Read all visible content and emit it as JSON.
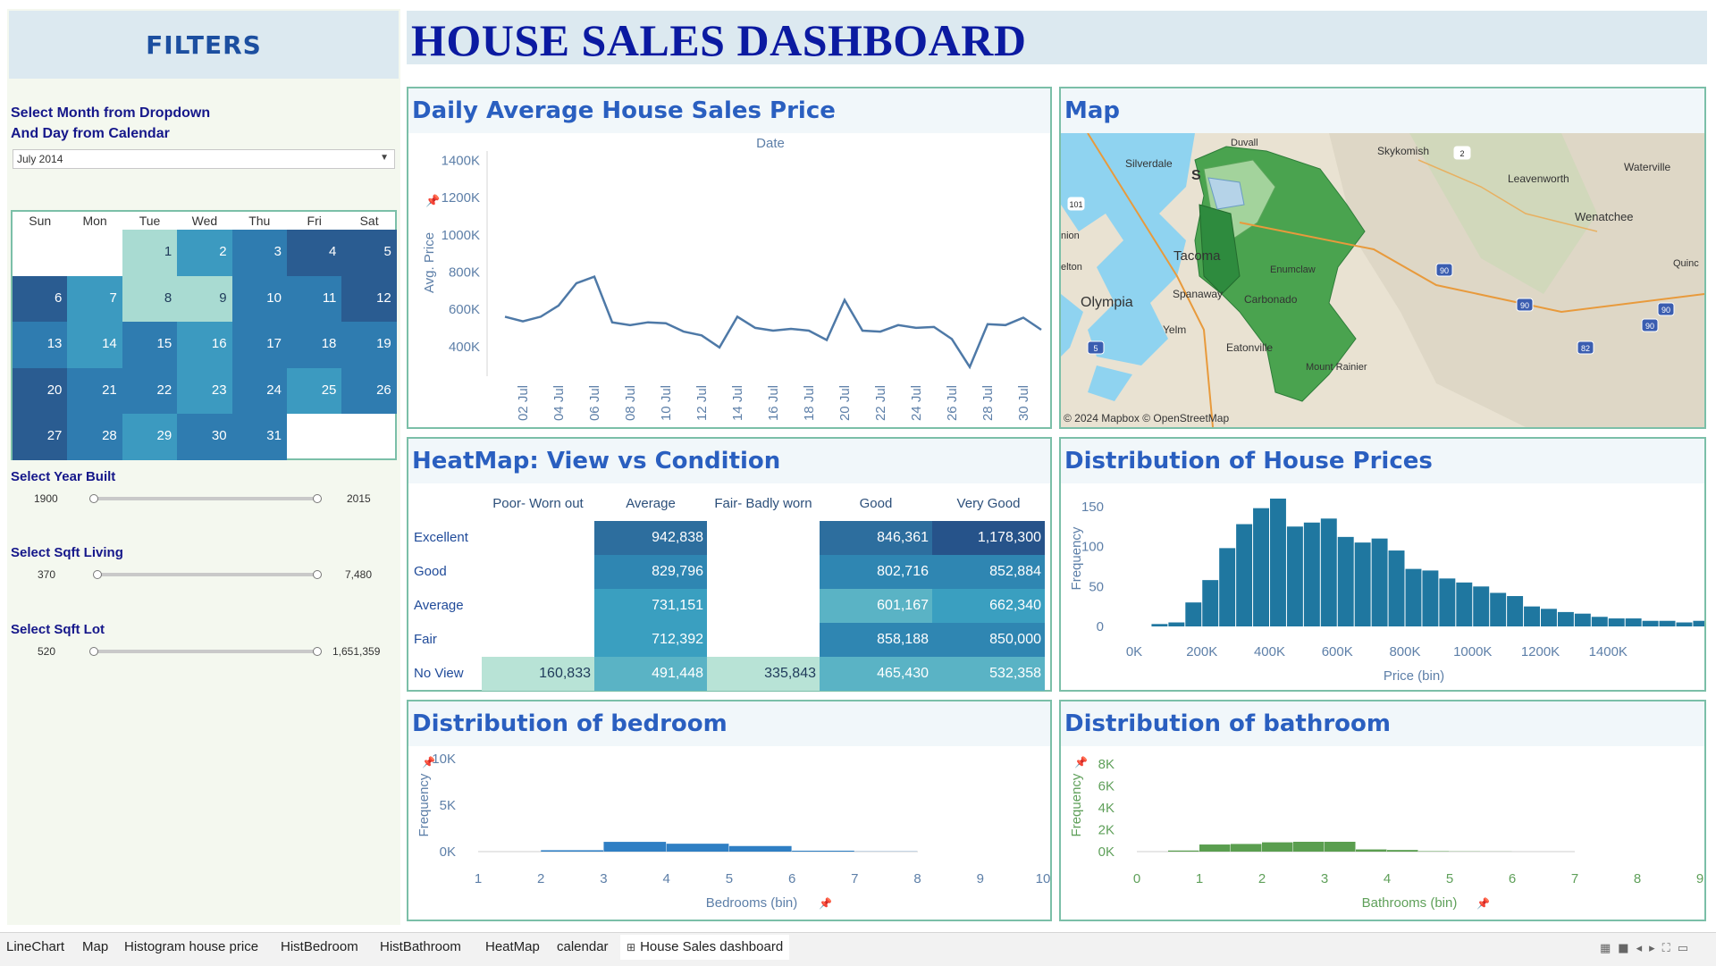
{
  "filters": {
    "header": "FILTERS",
    "month_label_1": "Select Month from Dropdown",
    "month_label_2": "And Day from Calendar",
    "month_value": "July 2014",
    "calendar": {
      "days": [
        "Sun",
        "Mon",
        "Tue",
        "Wed",
        "Thu",
        "Fri",
        "Sat"
      ],
      "start_offset": 2,
      "dates": [
        "1",
        "2",
        "3",
        "4",
        "5",
        "6",
        "7",
        "8",
        "9",
        "10",
        "11",
        "12",
        "13",
        "14",
        "15",
        "16",
        "17",
        "18",
        "19",
        "20",
        "21",
        "22",
        "23",
        "24",
        "25",
        "26",
        "27",
        "28",
        "29",
        "30",
        "31"
      ],
      "levels": [
        4,
        3,
        2,
        1,
        1,
        1,
        3,
        4,
        4,
        2,
        2,
        1,
        2,
        3,
        2,
        3,
        2,
        2,
        2,
        1,
        2,
        2,
        3,
        2,
        3,
        2,
        1,
        2,
        3,
        2,
        2
      ]
    },
    "year_built": {
      "label": "Select Year Built",
      "min": "1900",
      "max": "2015"
    },
    "sqft_living": {
      "label": "Select Sqft Living",
      "min": "370",
      "max": "7,480"
    },
    "sqft_lot": {
      "label": "Select Sqft Lot",
      "min": "520",
      "max": "1,651,359"
    }
  },
  "title": "HOUSE SALES DASHBOARD",
  "line_panel": {
    "title": "Daily Average House Sales Price"
  },
  "map_panel": {
    "title": "Map",
    "labels": {
      "duvall": "Duvall",
      "skykomish": "Skykomish",
      "waterville": "Waterville",
      "silverdale": "Silverdale",
      "seattle": "S",
      "leavenworth": "Leavenworth",
      "wenatchee": "Wenatchee",
      "tacoma": "Tacoma",
      "olympia": "Olympia",
      "spanaway": "Spanaway",
      "carbonado": "Carbonado",
      "yelm": "Yelm",
      "eatonville": "Eatonville",
      "enumclaw": "Enumclaw",
      "union": "nion",
      "shelton": "elton",
      "quincy": "Quinc",
      "rainier": "Mount Rainier"
    },
    "shields": {
      "r2": "2",
      "us101": "101",
      "i90a": "90",
      "i90b": "90",
      "i90c": "90",
      "i90d": "90",
      "i5": "5",
      "i82": "82"
    },
    "attribution": "© 2024 Mapbox © OpenStreetMap",
    "colors": {
      "water": "#8fd3f0",
      "land": "#e9e2d2",
      "county_dark": "#2e8b3e",
      "county_mid": "#4aa34f",
      "county_light": "#a3d39c"
    }
  },
  "heatmap_panel": {
    "title": "HeatMap: View vs Condition",
    "columns": [
      "Poor- Worn out",
      "Average",
      "Fair- Badly worn",
      "Good",
      "Very Good"
    ],
    "rows": [
      {
        "label": "Excellent",
        "values": [
          "",
          "942,838",
          "",
          "846,361",
          "1,178,300"
        ],
        "levels": [
          0,
          4,
          0,
          4,
          5
        ]
      },
      {
        "label": "Good",
        "values": [
          "",
          "829,796",
          "",
          "802,716",
          "852,884"
        ],
        "levels": [
          0,
          3,
          0,
          3,
          3
        ]
      },
      {
        "label": "Average",
        "values": [
          "",
          "731,151",
          "",
          "601,167",
          "662,340"
        ],
        "levels": [
          0,
          2,
          0,
          1,
          2
        ]
      },
      {
        "label": "Fair",
        "values": [
          "",
          "712,392",
          "",
          "858,188",
          "850,000"
        ],
        "levels": [
          0,
          2,
          0,
          3,
          3
        ]
      },
      {
        "label": "No View",
        "values": [
          "160,833",
          "491,448",
          "335,843",
          "465,430",
          "532,358"
        ],
        "levels": [
          -1,
          1,
          -1,
          1,
          1
        ]
      }
    ]
  },
  "price_panel": {
    "title": "Distribution of House Prices"
  },
  "bedroom_panel": {
    "title": "Distribution of bedroom"
  },
  "bathroom_panel": {
    "title": "Distribution of bathroom"
  },
  "chart_data": [
    {
      "type": "line",
      "title": "Daily Average House Sales Price",
      "xlabel": "Date",
      "ylabel": "Avg. Price",
      "x": [
        "01 Jul",
        "02 Jul",
        "03 Jul",
        "04 Jul",
        "05 Jul",
        "06 Jul",
        "07 Jul",
        "08 Jul",
        "09 Jul",
        "10 Jul",
        "11 Jul",
        "12 Jul",
        "13 Jul",
        "14 Jul",
        "15 Jul",
        "16 Jul",
        "17 Jul",
        "18 Jul",
        "19 Jul",
        "20 Jul",
        "21 Jul",
        "22 Jul",
        "23 Jul",
        "24 Jul",
        "25 Jul",
        "26 Jul",
        "27 Jul",
        "28 Jul",
        "29 Jul",
        "30 Jul",
        "31 Jul"
      ],
      "x_tick_labels": [
        "02 Jul",
        "04 Jul",
        "06 Jul",
        "08 Jul",
        "10 Jul",
        "12 Jul",
        "14 Jul",
        "16 Jul",
        "18 Jul",
        "20 Jul",
        "22 Jul",
        "24 Jul",
        "26 Jul",
        "28 Jul",
        "30 Jul"
      ],
      "y": [
        560000,
        535000,
        560000,
        620000,
        740000,
        775000,
        530000,
        515000,
        530000,
        525000,
        480000,
        460000,
        395000,
        560000,
        500000,
        485000,
        495000,
        485000,
        435000,
        650000,
        485000,
        480000,
        515000,
        500000,
        505000,
        440000,
        290000,
        520000,
        515000,
        555000,
        490000
      ],
      "y_tick_labels": [
        "400K",
        "600K",
        "800K",
        "1000K",
        "1200K",
        "1400K"
      ],
      "y_ticks": [
        400000,
        600000,
        800000,
        1000000,
        1200000,
        1400000
      ],
      "ylim": [
        250000,
        1450000
      ],
      "color": "#4e79a7"
    },
    {
      "type": "bar",
      "title": "Distribution of House Prices",
      "xlabel": "Price (bin)",
      "ylabel": "Frequency",
      "x_tick_labels": [
        "0K",
        "200K",
        "400K",
        "600K",
        "800K",
        "1000K",
        "1200K",
        "1400K"
      ],
      "x_ticks": [
        0,
        200000,
        400000,
        600000,
        800000,
        1000000,
        1200000,
        1400000
      ],
      "y_tick_labels": [
        "0",
        "50",
        "100",
        "150"
      ],
      "y_ticks": [
        0,
        50,
        100,
        150
      ],
      "bin_start": 50000,
      "bin_width": 50000,
      "values": [
        3,
        5,
        30,
        58,
        98,
        128,
        148,
        160,
        125,
        130,
        135,
        112,
        105,
        110,
        95,
        72,
        70,
        60,
        55,
        50,
        42,
        38,
        25,
        22,
        18,
        16,
        12,
        10,
        10,
        7,
        7,
        5,
        7,
        2,
        5,
        2,
        2,
        4
      ],
      "xlim": [
        0,
        1600000
      ],
      "ylim": [
        0,
        170
      ],
      "color": "#1f77a0"
    },
    {
      "type": "bar",
      "title": "Distribution of bedroom",
      "xlabel": "Bedrooms (bin)",
      "ylabel": "Frequency",
      "x_tick_labels": [
        "1",
        "2",
        "3",
        "4",
        "5",
        "6",
        "7",
        "8",
        "9",
        "10"
      ],
      "y_tick_labels": [
        "0K",
        "5K",
        "10K"
      ],
      "y_ticks": [
        0,
        5000,
        10000
      ],
      "bins": [
        2,
        3,
        4,
        5,
        6,
        7
      ],
      "values": [
        150,
        1050,
        850,
        600,
        100,
        20
      ],
      "xlim": [
        1,
        10
      ],
      "ylim": [
        0,
        10000
      ],
      "color": "#2f7fc4"
    },
    {
      "type": "bar",
      "title": "Distribution of bathroom",
      "xlabel": "Bathrooms (bin)",
      "ylabel": "Frequency",
      "x_tick_labels": [
        "0",
        "1",
        "2",
        "3",
        "4",
        "5",
        "6",
        "7",
        "8",
        "9"
      ],
      "y_tick_labels": [
        "0K",
        "2K",
        "4K",
        "6K",
        "8K"
      ],
      "y_ticks": [
        0,
        2000,
        4000,
        6000,
        8000
      ],
      "bins": [
        0.5,
        1.0,
        1.5,
        2.0,
        2.5,
        3.0,
        3.5,
        4.0,
        4.5,
        5.0,
        5.5
      ],
      "values": [
        100,
        650,
        700,
        850,
        900,
        900,
        200,
        150,
        40,
        20,
        10
      ],
      "xlim": [
        0,
        9
      ],
      "ylim": [
        0,
        8500
      ],
      "color": "#5a9e4f"
    }
  ],
  "tabs": [
    "LineChart",
    "Map",
    "Histogram house price",
    "HistBedroom",
    "HistBathroom",
    "HeatMap",
    "calendar",
    "House Sales dashboard"
  ],
  "active_tab": "House Sales dashboard"
}
